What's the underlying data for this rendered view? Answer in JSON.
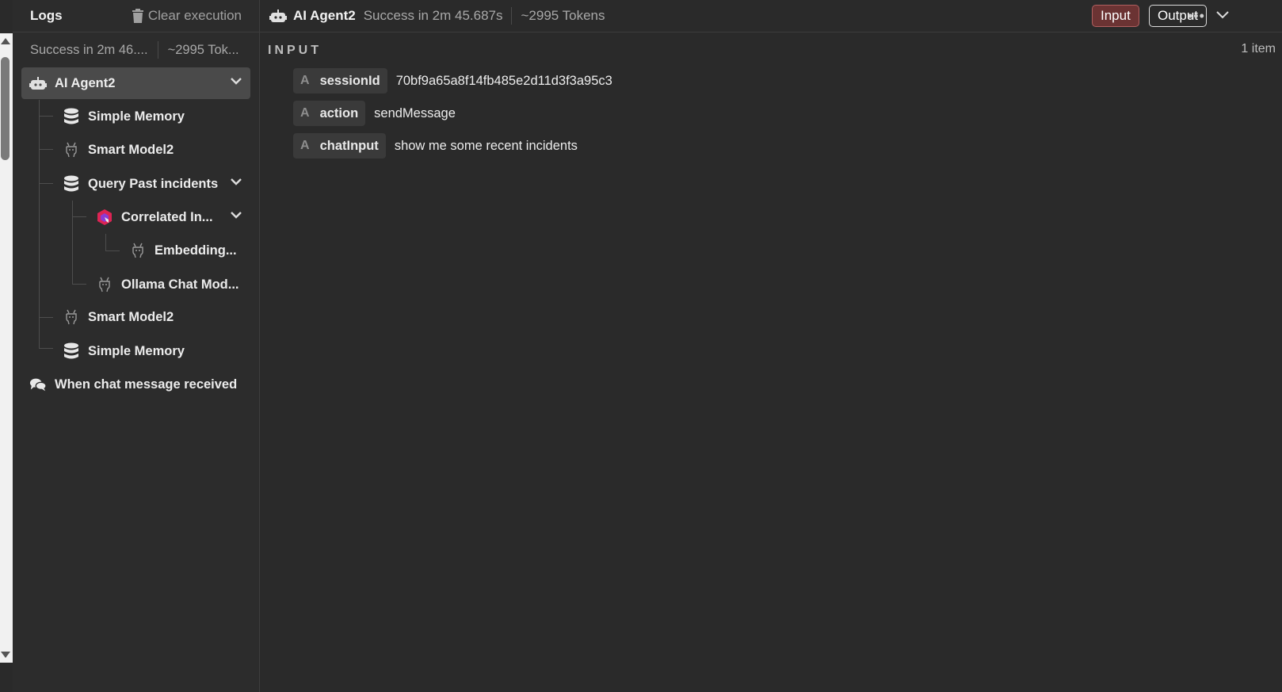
{
  "logs_panel": {
    "title": "Logs",
    "clear_label": "Clear execution",
    "status_text": "Success in 2m 46....",
    "tokens_text": "~2995 Tok..."
  },
  "tree": {
    "agent": "AI Agent2",
    "memory1": "Simple Memory",
    "model1": "Smart Model2",
    "query": "Query Past incidents",
    "correlated": "Correlated In...",
    "embedding": "Embedding...",
    "ollama": "Ollama Chat Mod...",
    "model2": "Smart Model2",
    "memory2": "Simple Memory",
    "trigger": "When chat message received"
  },
  "header": {
    "node_name": "AI Agent2",
    "status": "Success in 2m 45.687s",
    "tokens": "~2995 Tokens",
    "input_label": "Input",
    "output_label": "Output",
    "more_label": "•••"
  },
  "main": {
    "section_label": "INPUT",
    "item_count": "1 item",
    "fields": [
      {
        "type": "A",
        "key": "sessionId",
        "value": "70bf9a65a8f14fb485e2d11d3f3a95c3"
      },
      {
        "type": "A",
        "key": "action",
        "value": "sendMessage"
      },
      {
        "type": "A",
        "key": "chatInput",
        "value": "show me some recent incidents"
      }
    ]
  },
  "colors": {
    "background": "#2a2a2a",
    "selected_row": "#4a4a4a",
    "input_toggle": "#6b3333"
  }
}
